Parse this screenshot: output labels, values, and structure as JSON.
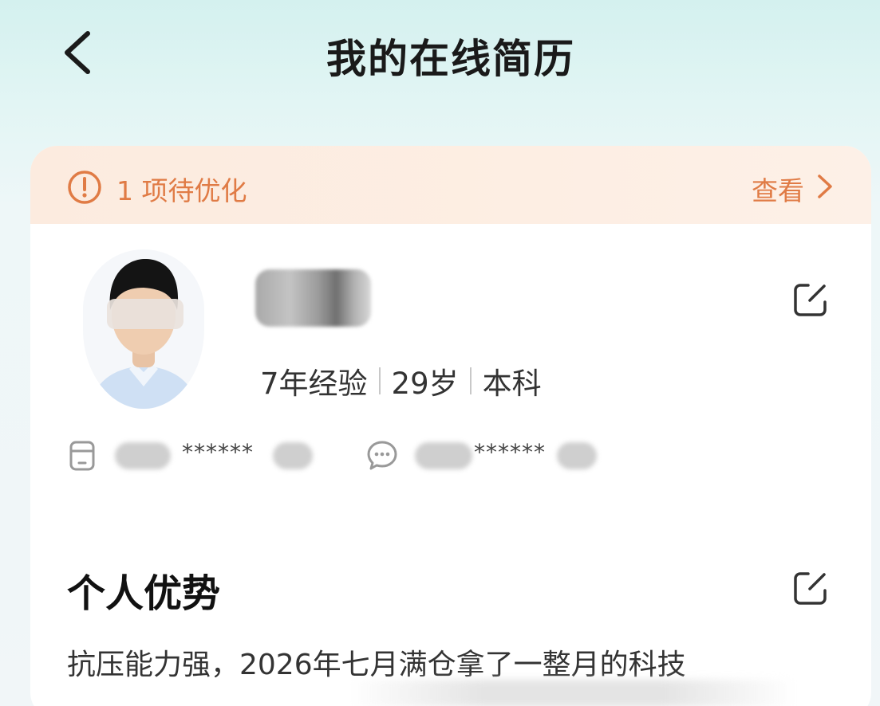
{
  "header": {
    "title": "我的在线简历"
  },
  "banner": {
    "text": "1 项待优化",
    "link_label": "查看"
  },
  "profile": {
    "experience": "7年经验",
    "age": "29岁",
    "education": "本科",
    "phone_masked": "******",
    "wechat_masked": "******"
  },
  "advantages": {
    "title": "个人优势",
    "text": "抗压能力强，2026年七月满仓拿了一整月的科技"
  },
  "colors": {
    "accent": "#e07b45",
    "banner_bg": "#fdeee3",
    "header_bg": "#d4f1ef"
  },
  "icons": {
    "back": "chevron-left-icon",
    "alert": "exclamation-circle-icon",
    "link": "chevron-right-icon",
    "edit": "edit-icon",
    "phone": "phone-icon",
    "wechat": "wechat-icon"
  }
}
